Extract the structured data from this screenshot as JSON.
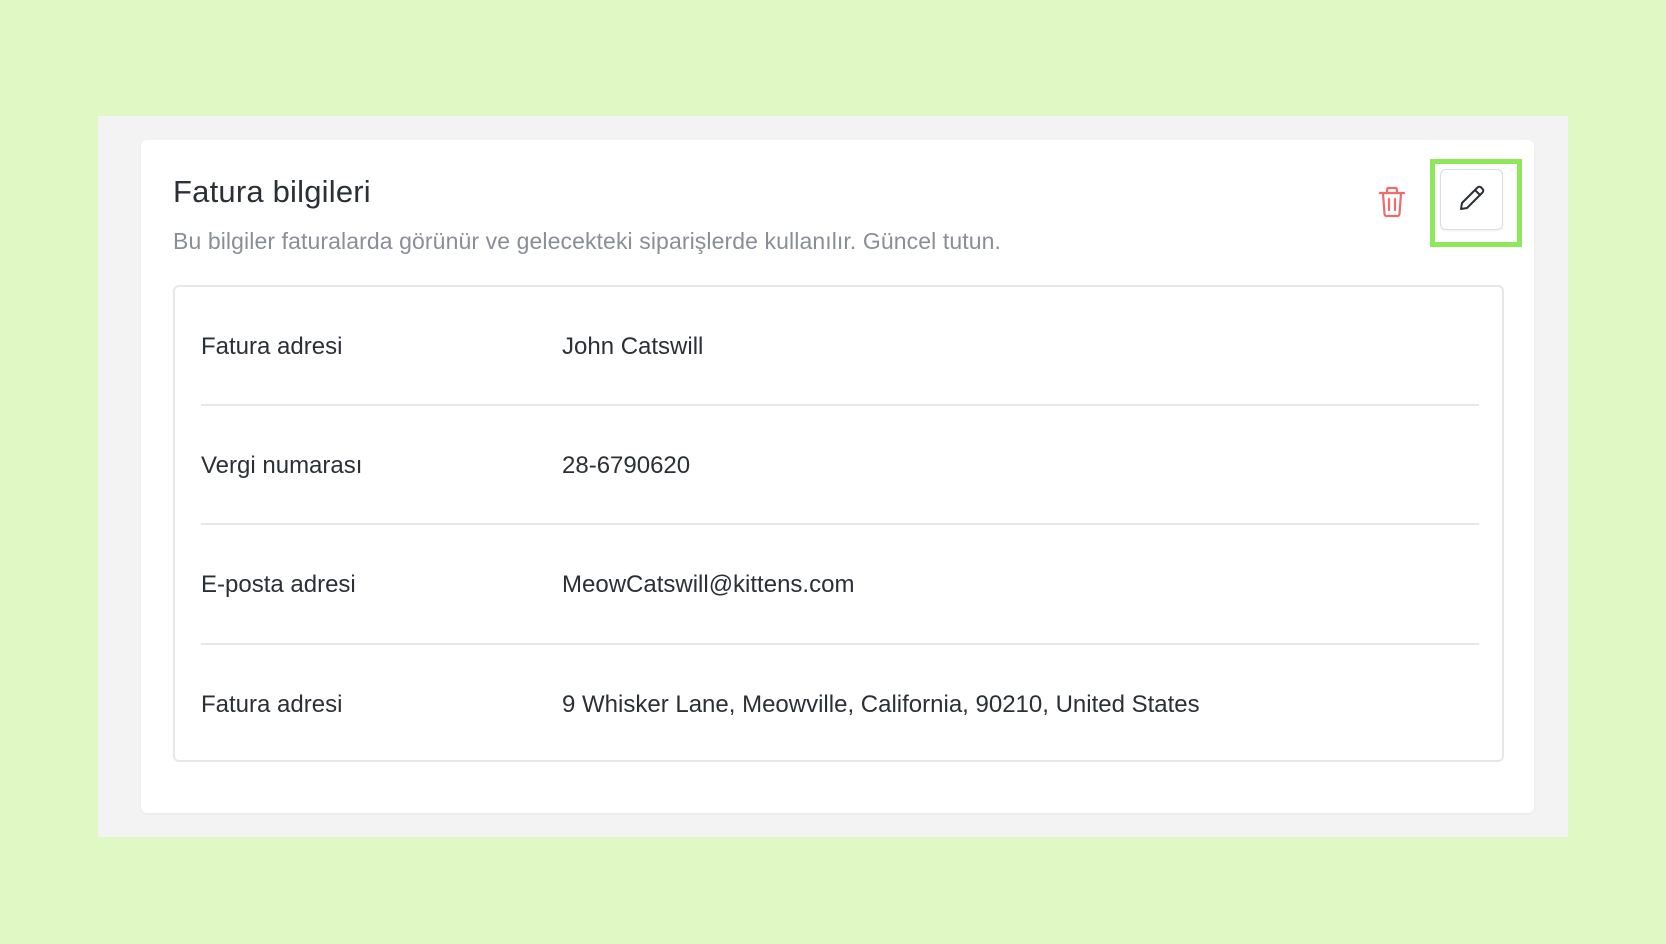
{
  "card": {
    "title": "Fatura bilgileri",
    "description": "Bu bilgiler faturalarda görünür ve gelecekteki siparişlerde kullanılır. Güncel tutun.",
    "delete_icon": "trash-icon",
    "edit_icon": "pencil-icon"
  },
  "rows": [
    {
      "label": "Fatura adresi",
      "value": "John Catswill"
    },
    {
      "label": "Vergi numarası",
      "value": "28-6790620"
    },
    {
      "label": "E-posta adresi",
      "value": "MeowCatswill@kittens.com"
    },
    {
      "label": "Fatura adresi",
      "value": "9 Whisker Lane, Meowville, California, 90210, United States"
    }
  ],
  "colors": {
    "background": "#e0f8c4",
    "panel": "#f3f3f3",
    "highlight": "#8de85c",
    "delete": "#f06b6b",
    "text": "#2b2f36",
    "muted": "#8a8e96"
  }
}
